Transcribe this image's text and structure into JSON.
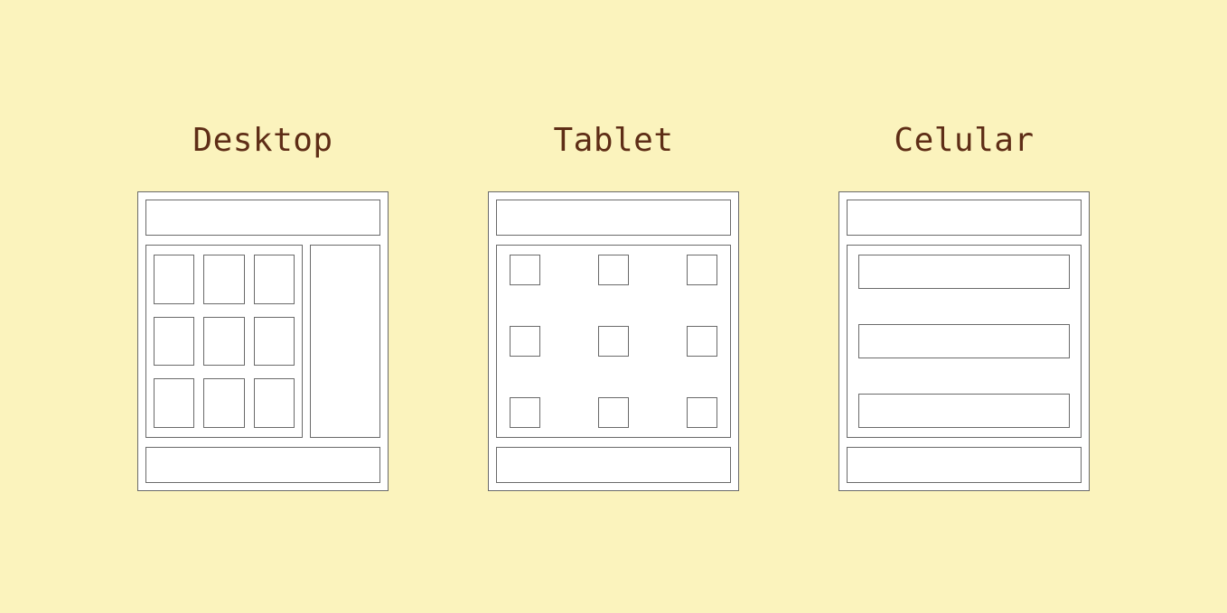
{
  "devices": [
    {
      "key": "desktop",
      "label": "Desktop"
    },
    {
      "key": "tablet",
      "label": "Tablet"
    },
    {
      "key": "celular",
      "label": "Celular"
    }
  ],
  "colors": {
    "background": "#fbf3bd",
    "stroke": "#6a6a6a",
    "text": "#5e2d16",
    "panel": "#ffffff"
  }
}
